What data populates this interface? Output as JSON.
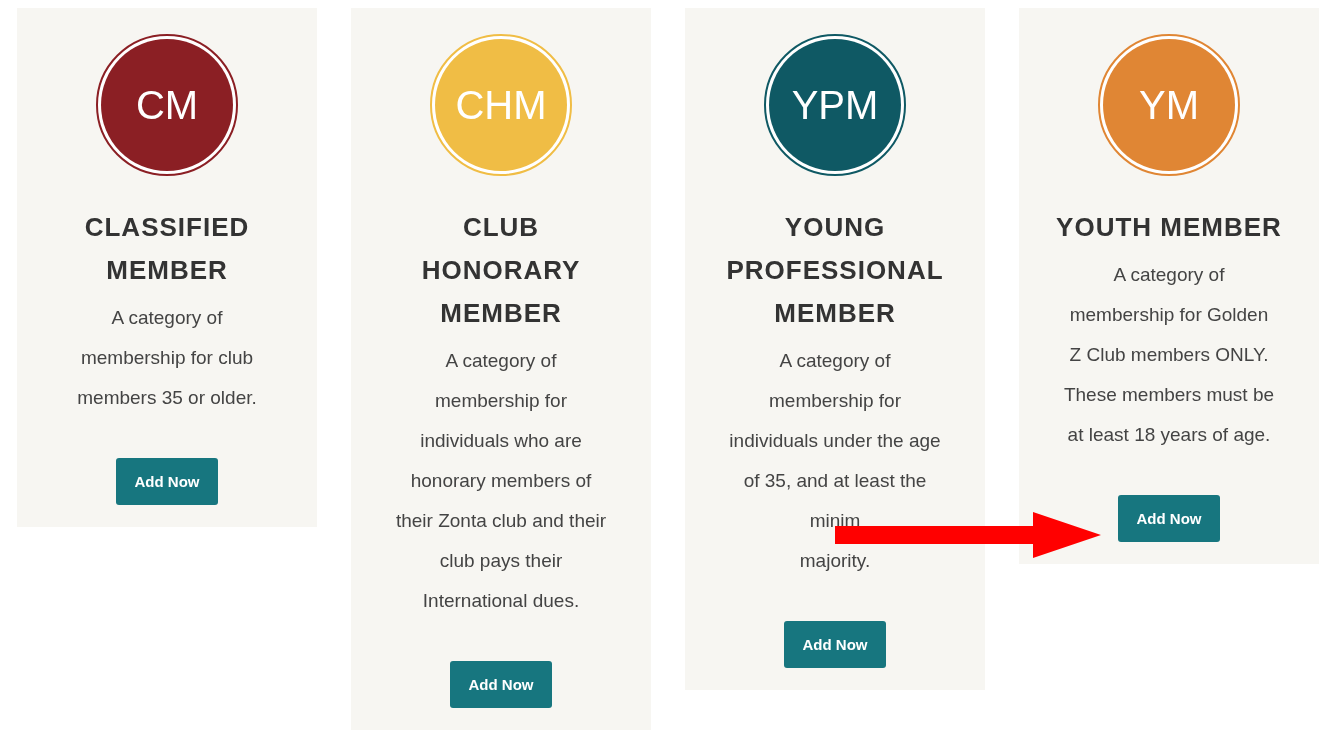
{
  "cards": [
    {
      "initials": "CM",
      "color": "#8b1f24",
      "title": "CLASSIFIED MEMBER",
      "description": "A category of membership for club members 35 or older.",
      "button": "Add Now"
    },
    {
      "initials": "CHM",
      "color": "#f0bd45",
      "title": "CLUB HONORARY MEMBER",
      "description": "A category of membership for individuals who are honorary members of their Zonta club and their club pays their International dues.",
      "button": "Add Now"
    },
    {
      "initials": "YPM",
      "color": "#0f5964",
      "title": "YOUNG PROFESSIONAL MEMBER",
      "description": "A category of membership for individuals under the age of 35, and at least the minim",
      "description_after": "majority.",
      "button": "Add Now"
    },
    {
      "initials": "YM",
      "color": "#e08634",
      "title": "YOUTH MEMBER",
      "description": "A category of membership for Golden Z Club members ONLY. These members must be at least 18 years of age.",
      "button": "Add Now"
    }
  ]
}
